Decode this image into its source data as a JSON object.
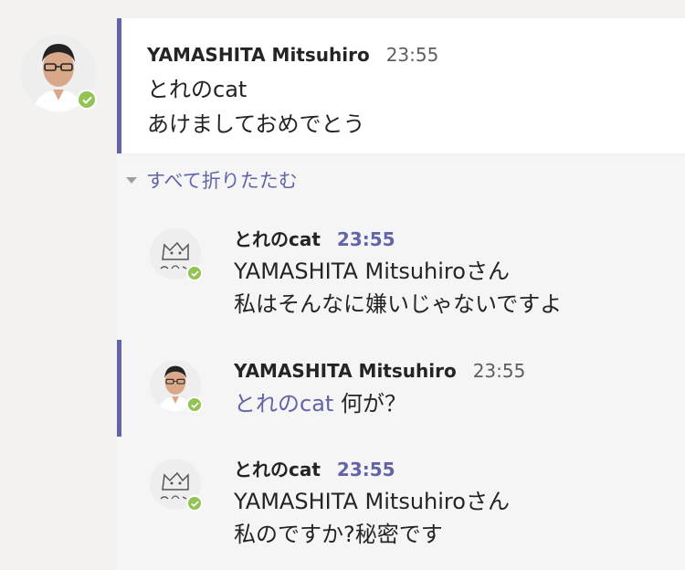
{
  "root": {
    "sender": "YAMASHITA Mitsuhiro",
    "time": "23:55",
    "mention": "とれのcat",
    "text": "あけましておめでとう",
    "avatar_icon": "person-photo-icon",
    "presence": "available"
  },
  "thread": {
    "collapse_label": "すべて折りたたむ"
  },
  "replies": [
    {
      "sender": "とれのcat",
      "time": "23:55",
      "lines": [
        "YAMASHITA Mitsuhiroさん",
        "私はそんなに嫌いじゃないですよ"
      ],
      "avatar_icon": "cat-drawing-icon"
    },
    {
      "sender": "YAMASHITA Mitsuhiro",
      "time": "23:55",
      "mention": "とれのcat",
      "text": "何が？",
      "avatar_icon": "person-photo-icon"
    },
    {
      "sender": "とれのcat",
      "time": "23:55",
      "lines": [
        "YAMASHITA Mitsuhiroさん",
        "私のですか?秘密です"
      ],
      "avatar_icon": "cat-drawing-icon"
    }
  ],
  "colors": {
    "accent": "#6264a7",
    "presence": "#92c353"
  }
}
